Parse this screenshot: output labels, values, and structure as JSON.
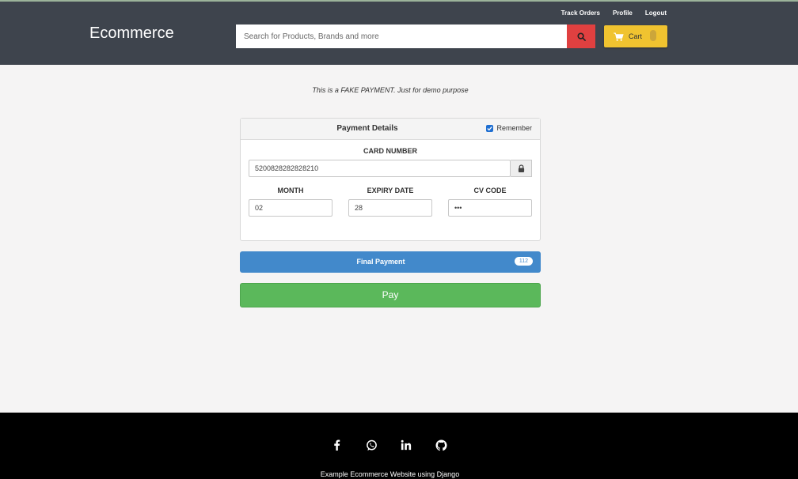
{
  "header": {
    "brand": "Ecommerce",
    "links": [
      "Track Orders",
      "Profile",
      "Logout"
    ],
    "search_placeholder": "Search for Products, Brands and more",
    "cart_label": "Cart"
  },
  "notice": "This is a FAKE PAYMENT. Just for demo purpose",
  "payment": {
    "title": "Payment Details",
    "remember_label": "Remember",
    "remember_checked": true,
    "card_number_label": "CARD NUMBER",
    "card_number_value": "5200828282828210",
    "month_label": "MONTH",
    "month_value": "02",
    "expiry_label": "EXPIRY DATE",
    "expiry_value": "28",
    "cv_label": "CV CODE",
    "cv_value": "•••"
  },
  "final_payment": {
    "label": "Final Payment",
    "amount": "112"
  },
  "pay_label": "Pay",
  "footer": {
    "social_icons": [
      "facebook-icon",
      "whatsapp-icon",
      "linkedin-icon",
      "github-icon"
    ],
    "text": "Example Ecommerce Website using Django"
  },
  "colors": {
    "header_bg": "#3e444d",
    "search_button": "#e04040",
    "cart_button": "#f0c330",
    "final_bar": "#4289cb",
    "pay_button": "#5bb85b",
    "footer_bg": "#000000"
  }
}
